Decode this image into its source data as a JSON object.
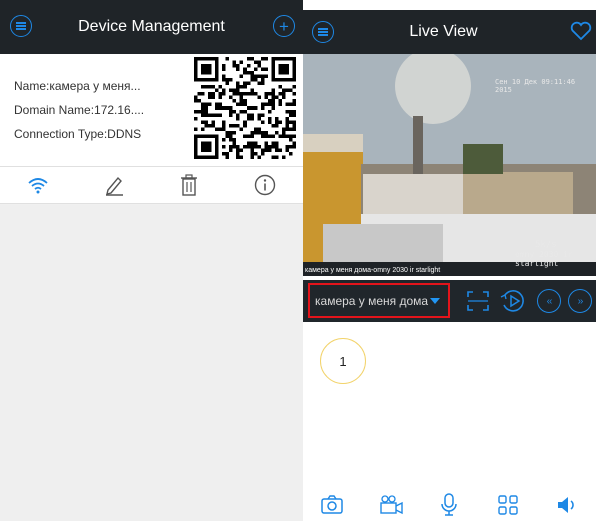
{
  "device_management": {
    "title": "Device Management",
    "menu_icon": "menu-icon",
    "add_icon": "add-icon",
    "device": {
      "name": "Name:камера у меня...",
      "domain": "Domain Name:172.16....",
      "connection": "Connection Type:DDNS"
    },
    "actions": [
      "wifi-icon",
      "edit-icon",
      "delete-icon",
      "info-icon"
    ]
  },
  "live_view": {
    "title": "Live View",
    "menu_icon": "menu-icon",
    "favorite_icon": "heart-icon",
    "video": {
      "caption": "камера у меня дома-omny 2030 ir starlight",
      "osd_datetime": "Сен 10 Дек 09:11:46 2015",
      "osd_name": "omny 2030 ir starlight",
      "osd_rate": "5k/s"
    },
    "camera_select": "камера у меня дома",
    "controls": [
      "fullscreen-icon",
      "playback-icon",
      "previous-icon",
      "next-icon"
    ],
    "channel_number": "1",
    "toolbar": [
      "snapshot-icon",
      "record-icon",
      "microphone-icon",
      "grid-icon",
      "speaker-icon"
    ]
  },
  "colors": {
    "accent": "#1e88e5",
    "topbar": "#1f2428",
    "highlight": "#e3141b",
    "channel_ring": "#f2d36b"
  }
}
